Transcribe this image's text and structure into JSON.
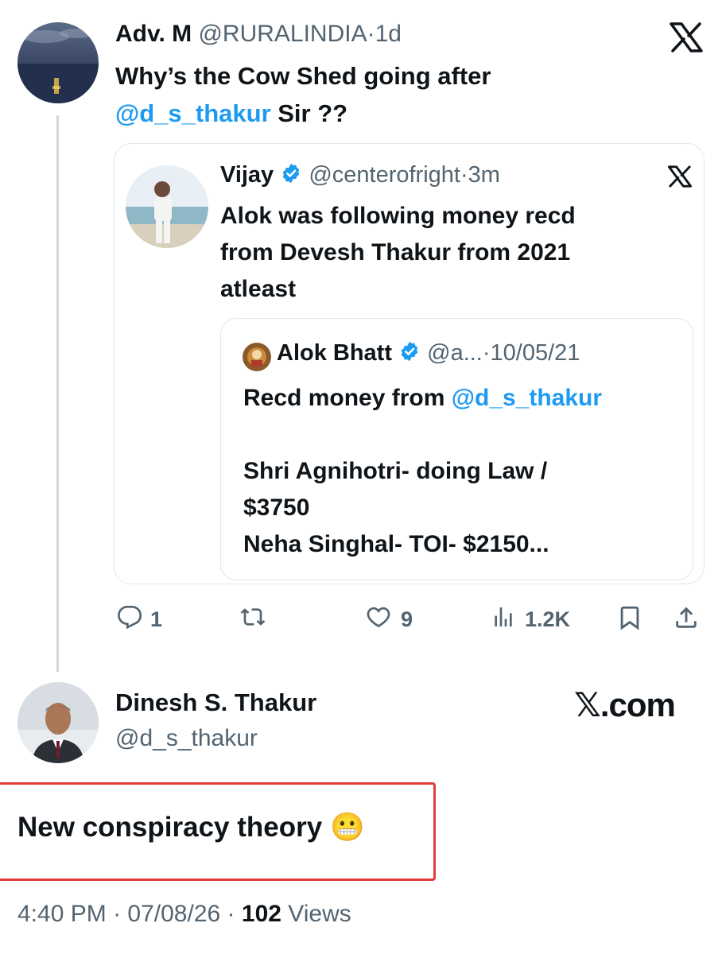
{
  "reply_tweet": {
    "display_name": "Adv. M",
    "handle": "@RURALINDIA",
    "dot": "·",
    "age": "1d",
    "text_part1": "Why’s the Cow Shed going after",
    "mention": "@d_s_thakur",
    "text_part2": " Sir ??"
  },
  "quote_tweet": {
    "display_name": "Vijay",
    "handle": "@centerofright",
    "dot": "·",
    "age": "3m",
    "text_line1": "Alok was following money recd",
    "text_line2": "from Devesh Thakur from 2021",
    "text_line3": "atleast"
  },
  "nested_quote": {
    "display_name": "Alok Bhatt",
    "handle": "@a...",
    "dot": "·",
    "date": "10/05/21",
    "text_prefix": "Recd money from ",
    "mention": "@d_s_thakur",
    "line2": "Shri Agnihotri- doing Law /",
    "line3": "$3750",
    "line4": "Neha Singhal- TOI- $2150..."
  },
  "actions": {
    "replies": "1",
    "reposts": "",
    "likes": "9",
    "views": "1.2K"
  },
  "main_tweet": {
    "display_name": "Dinesh S. Thakur",
    "handle": "@d_s_thakur",
    "brand": "𝕏.com",
    "text": "New conspiracy theory",
    "emoji": "😬",
    "time": "4:40 PM",
    "sep1": "·",
    "date": "07/08/26",
    "sep2": "·",
    "views_count": "102",
    "views_label": "Views"
  },
  "icons": {
    "x_logo": "x-logo-icon",
    "verified": "verified-badge-icon",
    "reply": "reply-icon",
    "repost": "repost-icon",
    "like": "heart-icon",
    "views": "views-icon",
    "bookmark": "bookmark-icon",
    "share": "share-icon"
  },
  "colors": {
    "link": "#1d9bf0",
    "muted": "#536471",
    "highlight_box": "#e23b3b"
  }
}
